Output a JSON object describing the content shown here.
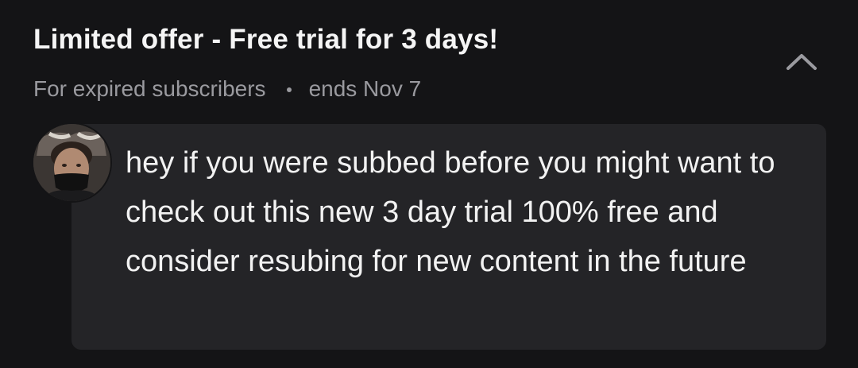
{
  "offer": {
    "title": "Limited offer - Free trial for 3 days!",
    "audience": "For expired subscribers",
    "expiry": "ends Nov 7"
  },
  "icons": {
    "collapse": "chevron-up-icon",
    "separator": "dot-separator"
  },
  "message": {
    "avatar": "user-avatar",
    "text": "hey if you were subbed before you might want to check out this new 3 day trial 100% free and consider resubing for new content in the future"
  },
  "colors": {
    "background": "#141416",
    "bubble": "#242427",
    "primary_text": "#f5f5f5",
    "secondary_text": "#9a9a9f"
  }
}
